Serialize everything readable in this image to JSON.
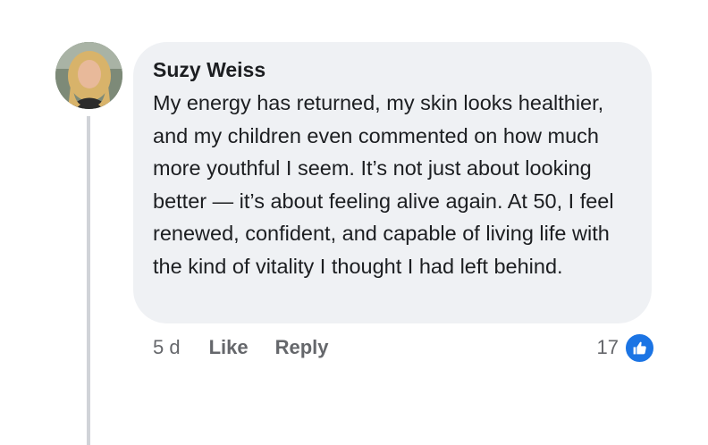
{
  "comment": {
    "author": "Suzy Weiss",
    "text": "My energy has returned, my skin looks healthier, and my children even commented on how much more youthful I seem. It’s not just about looking better — it’s about feeling alive again. At 50, I feel renewed, confident, and capable of living life with the kind of vitality I thought I had left behind.",
    "avatar_icon": "profile-photo",
    "timestamp": "5 d",
    "actions": {
      "like_label": "Like",
      "reply_label": "Reply"
    },
    "reactions": {
      "count": "17",
      "icon": "thumbs-up-icon",
      "color": "#1b74e4"
    }
  },
  "colors": {
    "bubble_background": "#eff1f4",
    "primary_text": "#1c1e21",
    "secondary_text": "#65676b",
    "thread_line": "#d0d3d8"
  }
}
